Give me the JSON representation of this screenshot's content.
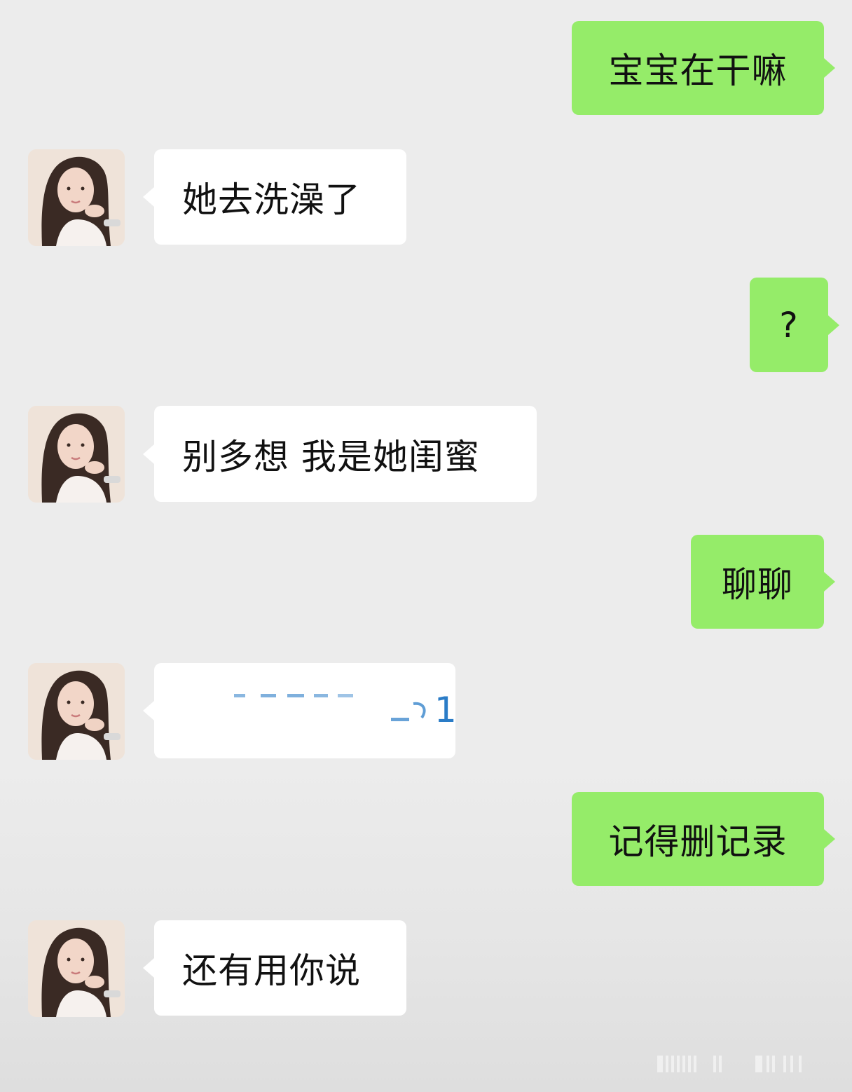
{
  "messages": [
    {
      "side": "out",
      "text": "宝宝在干嘛"
    },
    {
      "side": "in",
      "text": "她去洗澡了"
    },
    {
      "side": "out",
      "text": "?"
    },
    {
      "side": "in",
      "text": "别多想 我是她闺蜜"
    },
    {
      "side": "out",
      "text": "聊聊"
    },
    {
      "side": "in",
      "text_visible_end": "1",
      "redacted": true
    },
    {
      "side": "out",
      "text": "记得删记录"
    },
    {
      "side": "in",
      "text": "还有用你说"
    }
  ],
  "colors": {
    "outgoing_bubble": "#95ec69",
    "incoming_bubble": "#ffffff",
    "background": "#ececec",
    "link_text": "#2a7cc7"
  },
  "icons": {
    "avatar": "contact-avatar-photo"
  }
}
